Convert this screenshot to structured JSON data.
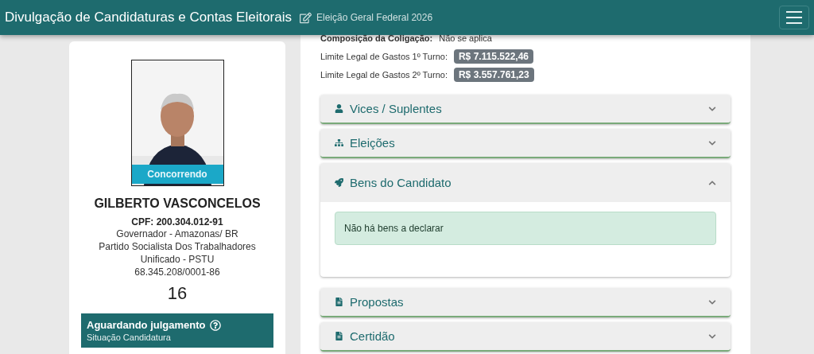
{
  "header": {
    "title": "Divulgação de Candidaturas e Contas Eleitorais",
    "election": "Eleição Geral Federal 2026"
  },
  "candidate": {
    "photo_badge": "Concorrendo",
    "name": "GILBERTO VASCONCELOS",
    "cpf": "CPF: 200.304.012-91",
    "lines": [
      "Governador - Amazonas/ BR",
      "Partido Socialista Dos Trabalhadores Unificado - PSTU",
      "68.345.208/0001-86"
    ],
    "number": "16",
    "status": {
      "title": "Aguardando julgamento",
      "subtitle": "Situação Candidatura"
    }
  },
  "details": [
    {
      "label": "Composição da Coligação:",
      "value": "Não se aplica",
      "kind": "text"
    },
    {
      "label": "Limite Legal de Gastos 1º Turno:",
      "value": "R$ 7.115.522,46",
      "kind": "badge"
    },
    {
      "label": "Limite Legal de Gastos 2º Turno:",
      "value": "R$ 3.557.761,23",
      "kind": "badge"
    }
  ],
  "sections": [
    {
      "title": "Vices / Suplentes",
      "expanded": false
    },
    {
      "title": "Eleições",
      "expanded": false
    },
    {
      "title": "Bens do Candidato",
      "expanded": true,
      "message": "Não há bens a declarar"
    },
    {
      "title": "Propostas",
      "expanded": false
    },
    {
      "title": "Certidão",
      "expanded": false
    }
  ]
}
